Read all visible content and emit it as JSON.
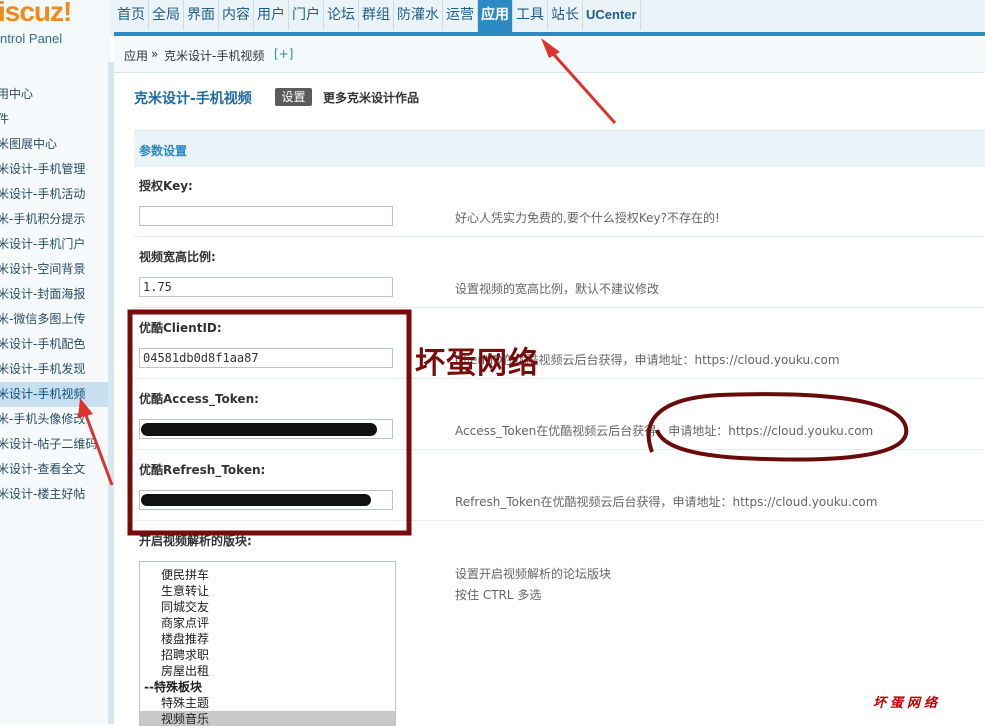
{
  "logo": {
    "brand": "iscuz!",
    "subtitle": "ntrol Panel"
  },
  "topnav": {
    "items": [
      "首页",
      "全局",
      "界面",
      "内容",
      "用户",
      "门户",
      "论坛",
      "群组",
      "防灌水",
      "运营",
      "应用",
      "工具",
      "站长",
      "UCenter"
    ],
    "active": "应用"
  },
  "breadcrumb": {
    "root": "应用",
    "sep": "»",
    "current": "克米设计-手机视频",
    "add": "[+]"
  },
  "sidebar": {
    "items": [
      {
        "label": "用中心"
      },
      {
        "label": "件"
      },
      {
        "label": "米图展中心"
      },
      {
        "label": "米设计-手机管理"
      },
      {
        "label": "米设计-手机活动"
      },
      {
        "label": "米-手机积分提示"
      },
      {
        "label": "米设计-手机门户"
      },
      {
        "label": "米设计-空间背景"
      },
      {
        "label": "米设计-封面海报"
      },
      {
        "label": "米-微信多图上传"
      },
      {
        "label": "米设计-手机配色"
      },
      {
        "label": "米设计-手机发现"
      },
      {
        "label": "米设计-手机视频",
        "active": true
      },
      {
        "label": "米-手机头像修改"
      },
      {
        "label": "米设计-帖子二维码"
      },
      {
        "label": "米设计-查看全文"
      },
      {
        "label": "米设计-楼主好帖"
      }
    ]
  },
  "plugin": {
    "title": "克米设计-手机视频",
    "tab_settings": "设置",
    "more": "更多克米设计作品"
  },
  "section": {
    "title": "参数设置"
  },
  "fields": {
    "auth_key": {
      "label": "授权Key:",
      "value": "",
      "hint": "好心人凭实力免费的,要个什么授权Key?不存在的!"
    },
    "ratio": {
      "label": "视频宽高比例:",
      "value": "1.75",
      "hint": "设置视频的宽高比例，默认不建议修改"
    },
    "client_id": {
      "label": "优酷ClientID:",
      "value": "04581db0d8f1aa87",
      "hint": "ClientID在优酷视频云后台获得，申请地址：https://cloud.youku.com"
    },
    "access_token": {
      "label": "优酷Access_Token:",
      "value": "",
      "hint": "Access_Token在优酷视频云后台获得，申请地址：https://cloud.youku.com"
    },
    "refresh_token": {
      "label": "优酷Refresh_Token:",
      "value": "",
      "hint": "Refresh_Token在优酷视频云后台获得，申请地址：https://cloud.youku.com"
    },
    "forums": {
      "label": "开启视频解析的版块:",
      "hint1": "设置开启视频解析的论坛版块",
      "hint2": "按住 CTRL 多选"
    }
  },
  "forum_options": [
    {
      "label": "便民拼车"
    },
    {
      "label": "生意转让"
    },
    {
      "label": "同城交友"
    },
    {
      "label": "商家点评"
    },
    {
      "label": "楼盘推荐"
    },
    {
      "label": "招聘求职"
    },
    {
      "label": "房屋出租"
    },
    {
      "label": "--特殊板块",
      "group": true
    },
    {
      "label": "特殊主题"
    },
    {
      "label": "视频音乐",
      "selected": true
    }
  ],
  "watermarks": {
    "big": "坏蛋网络",
    "small": "坏蛋网络"
  },
  "colors": {
    "accent": "#2b89c4",
    "annotation_dark_red": "#7a0b0b",
    "arrow_red": "#e0312c",
    "logo_orange": "#f08a1c"
  }
}
